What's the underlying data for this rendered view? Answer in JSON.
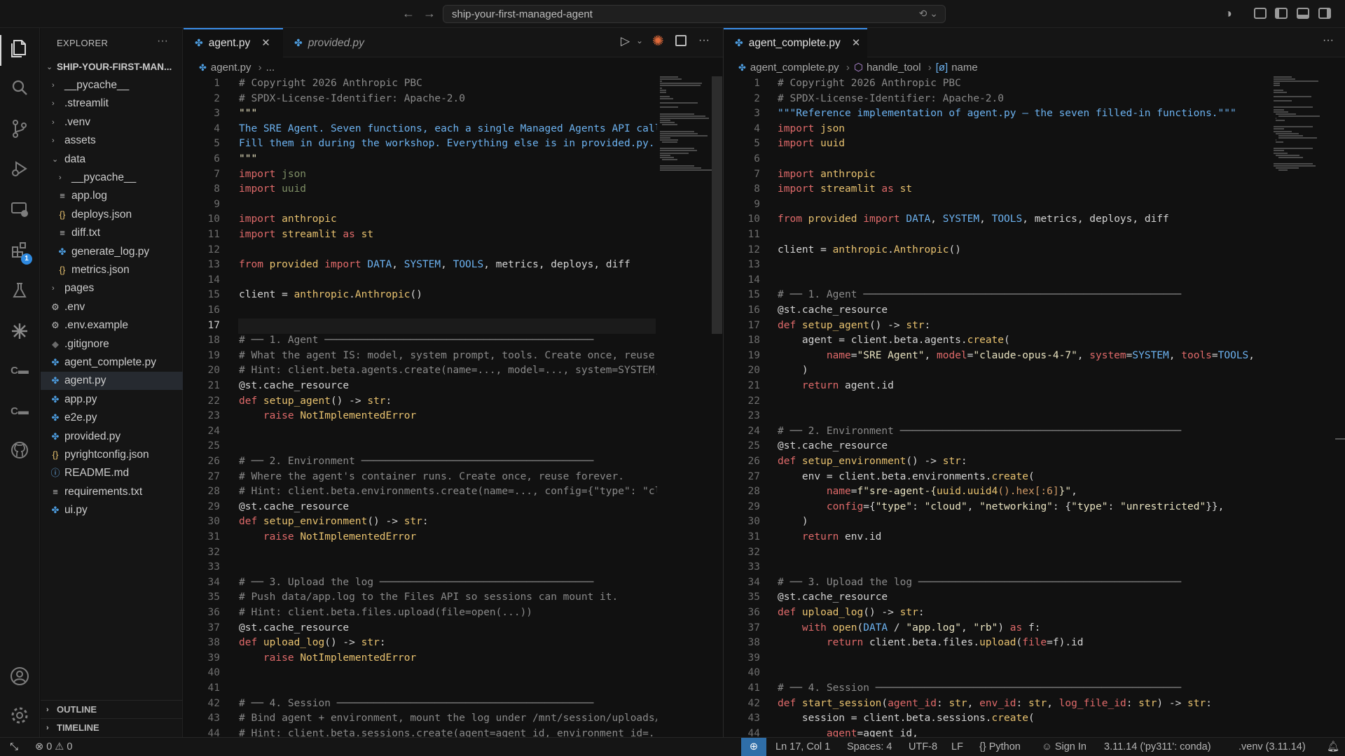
{
  "window": {
    "search_text": "ship-your-first-managed-agent"
  },
  "sidebar": {
    "title": "EXPLORER",
    "more": "···",
    "root": "SHIP-YOUR-FIRST-MAN...",
    "tree": [
      {
        "name": "__pycache__",
        "kind": "folder",
        "depth": 1,
        "open": false
      },
      {
        "name": ".streamlit",
        "kind": "folder",
        "depth": 1,
        "open": false
      },
      {
        "name": ".venv",
        "kind": "folder",
        "depth": 1,
        "open": false
      },
      {
        "name": "assets",
        "kind": "folder",
        "depth": 1,
        "open": false
      },
      {
        "name": "data",
        "kind": "folder",
        "depth": 1,
        "open": true
      },
      {
        "name": "__pycache__",
        "kind": "folder",
        "depth": 2,
        "open": false
      },
      {
        "name": "app.log",
        "kind": "text",
        "depth": 2
      },
      {
        "name": "deploys.json",
        "kind": "json",
        "depth": 2
      },
      {
        "name": "diff.txt",
        "kind": "text",
        "depth": 2
      },
      {
        "name": "generate_log.py",
        "kind": "python",
        "depth": 2
      },
      {
        "name": "metrics.json",
        "kind": "json",
        "depth": 2
      },
      {
        "name": "pages",
        "kind": "folder",
        "depth": 1,
        "open": false
      },
      {
        "name": ".env",
        "kind": "gear",
        "depth": 1
      },
      {
        "name": ".env.example",
        "kind": "gear",
        "depth": 1
      },
      {
        "name": ".gitignore",
        "kind": "git",
        "depth": 1
      },
      {
        "name": "agent_complete.py",
        "kind": "python",
        "depth": 1
      },
      {
        "name": "agent.py",
        "kind": "python",
        "depth": 1,
        "selected": true
      },
      {
        "name": "app.py",
        "kind": "python",
        "depth": 1
      },
      {
        "name": "e2e.py",
        "kind": "python",
        "depth": 1
      },
      {
        "name": "provided.py",
        "kind": "python",
        "depth": 1
      },
      {
        "name": "pyrightconfig.json",
        "kind": "json",
        "depth": 1
      },
      {
        "name": "README.md",
        "kind": "info",
        "depth": 1
      },
      {
        "name": "requirements.txt",
        "kind": "text",
        "depth": 1
      },
      {
        "name": "ui.py",
        "kind": "python",
        "depth": 1
      }
    ],
    "outline": "OUTLINE",
    "timeline": "TIMELINE"
  },
  "activity": {
    "extensions_badge": "1"
  },
  "left_editor": {
    "tabs": [
      {
        "label": "agent.py",
        "active": true,
        "italic": false,
        "close": "✕"
      },
      {
        "label": "provided.py",
        "active": false,
        "italic": true,
        "close": ""
      }
    ],
    "breadcrumb": [
      "agent.py",
      "..."
    ],
    "current_line": 17,
    "lines": [
      [
        [
          "# Copyright 2026 Anthropic PBC",
          "com"
        ]
      ],
      [
        [
          "# SPDX-License-Identifier: Apache-2.0",
          "com"
        ]
      ],
      [
        [
          "\"\"\"",
          "str"
        ]
      ],
      [
        [
          "The SRE Agent. Seven functions, each a single Managed Agents API call.",
          "blue"
        ]
      ],
      [
        [
          "Fill them in during the workshop. Everything else is in provided.py.",
          "blue"
        ]
      ],
      [
        [
          "\"\"\"",
          "str"
        ]
      ],
      [
        [
          "import ",
          "kw"
        ],
        [
          "json",
          "dim"
        ]
      ],
      [
        [
          "import ",
          "kw"
        ],
        [
          "uuid",
          "dim"
        ]
      ],
      [],
      [
        [
          "import ",
          "kw"
        ],
        [
          "anthropic",
          "fn"
        ]
      ],
      [
        [
          "import ",
          "kw"
        ],
        [
          "streamlit ",
          "fn"
        ],
        [
          "as ",
          "kw"
        ],
        [
          "st",
          "fn"
        ]
      ],
      [],
      [
        [
          "from ",
          "kw"
        ],
        [
          "provided ",
          "fn"
        ],
        [
          "import ",
          "kw"
        ],
        [
          "DATA",
          "blue"
        ],
        [
          ", ",
          ""
        ],
        [
          "SYSTEM",
          "blue"
        ],
        [
          ", ",
          ""
        ],
        [
          "TOOLS",
          "blue"
        ],
        [
          ", metrics, deploys, diff",
          ""
        ]
      ],
      [],
      [
        [
          "client = ",
          ""
        ],
        [
          "anthropic",
          "fn"
        ],
        [
          ".",
          ""
        ],
        [
          "Anthropic",
          "fn"
        ],
        [
          "()",
          ""
        ]
      ],
      [],
      [],
      [
        [
          "# ── 1. Agent ────────────────────────────────────────────",
          "com"
        ]
      ],
      [
        [
          "# What the agent IS: model, system prompt, tools. Create once, reuse forever.",
          "com"
        ]
      ],
      [
        [
          "# Hint: client.beta.agents.create(name=..., model=..., system=SYSTEM, tools=TOOLS)",
          "com"
        ]
      ],
      [
        [
          "@st",
          ""
        ],
        [
          ".cache_resource",
          ""
        ]
      ],
      [
        [
          "def ",
          "kw"
        ],
        [
          "setup_agent",
          "fn"
        ],
        [
          "() -> ",
          ""
        ],
        [
          "str",
          "fn"
        ],
        [
          ":",
          ""
        ]
      ],
      [
        [
          "    raise ",
          "kw"
        ],
        [
          "NotImplementedError",
          "fn"
        ]
      ],
      [],
      [],
      [
        [
          "# ── 2. Environment ──────────────────────────────────────",
          "com"
        ]
      ],
      [
        [
          "# Where the agent's container runs. Create once, reuse forever.",
          "com"
        ]
      ],
      [
        [
          "# Hint: client.beta.environments.create(name=..., config={\"type\": \"cloud\", ...})",
          "com"
        ]
      ],
      [
        [
          "@st",
          ""
        ],
        [
          ".cache_resource",
          ""
        ]
      ],
      [
        [
          "def ",
          "kw"
        ],
        [
          "setup_environment",
          "fn"
        ],
        [
          "() -> ",
          ""
        ],
        [
          "str",
          "fn"
        ],
        [
          ":",
          ""
        ]
      ],
      [
        [
          "    raise ",
          "kw"
        ],
        [
          "NotImplementedError",
          "fn"
        ]
      ],
      [],
      [],
      [
        [
          "# ── 3. Upload the log ───────────────────────────────────",
          "com"
        ]
      ],
      [
        [
          "# Push data/app.log to the Files API so sessions can mount it.",
          "com"
        ]
      ],
      [
        [
          "# Hint: client.beta.files.upload(file=open(...))",
          "com"
        ]
      ],
      [
        [
          "@st",
          ""
        ],
        [
          ".cache_resource",
          ""
        ]
      ],
      [
        [
          "def ",
          "kw"
        ],
        [
          "upload_log",
          "fn"
        ],
        [
          "() -> ",
          ""
        ],
        [
          "str",
          "fn"
        ],
        [
          ":",
          ""
        ]
      ],
      [
        [
          "    raise ",
          "kw"
        ],
        [
          "NotImplementedError",
          "fn"
        ]
      ],
      [],
      [],
      [
        [
          "# ── 4. Session ──────────────────────────────────────────",
          "com"
        ]
      ],
      [
        [
          "# Bind agent + environment, mount the log under /mnt/session/uploads/",
          "com"
        ]
      ],
      [
        [
          "# Hint: client.beta.sessions.create(agent=agent_id, environment_id=..., resources=[...])",
          "com"
        ]
      ]
    ]
  },
  "right_editor": {
    "tabs": [
      {
        "label": "agent_complete.py",
        "active": true,
        "italic": false,
        "close": "✕"
      }
    ],
    "breadcrumb": [
      "agent_complete.py",
      "handle_tool",
      "name"
    ],
    "lines": [
      [
        [
          "# Copyright 2026 Anthropic PBC",
          "com"
        ]
      ],
      [
        [
          "# SPDX-License-Identifier: Apache-2.0",
          "com"
        ]
      ],
      [
        [
          "\"\"\"Reference implementation of agent.py — the seven filled-in functions.\"\"\"",
          "blue"
        ]
      ],
      [
        [
          "import ",
          "kw"
        ],
        [
          "json",
          "fn"
        ]
      ],
      [
        [
          "import ",
          "kw"
        ],
        [
          "uuid",
          "fn"
        ]
      ],
      [],
      [
        [
          "import ",
          "kw"
        ],
        [
          "anthropic",
          "fn"
        ]
      ],
      [
        [
          "import ",
          "kw"
        ],
        [
          "streamlit ",
          "fn"
        ],
        [
          "as ",
          "kw"
        ],
        [
          "st",
          "fn"
        ]
      ],
      [],
      [
        [
          "from ",
          "kw"
        ],
        [
          "provided ",
          "fn"
        ],
        [
          "import ",
          "kw"
        ],
        [
          "DATA",
          "blue"
        ],
        [
          ", ",
          ""
        ],
        [
          "SYSTEM",
          "blue"
        ],
        [
          ", ",
          ""
        ],
        [
          "TOOLS",
          "blue"
        ],
        [
          ", metrics, deploys, diff",
          ""
        ]
      ],
      [],
      [
        [
          "client = ",
          ""
        ],
        [
          "anthropic",
          "fn"
        ],
        [
          ".",
          ""
        ],
        [
          "Anthropic",
          "fn"
        ],
        [
          "()",
          ""
        ]
      ],
      [],
      [],
      [
        [
          "# ── 1. Agent ────────────────────────────────────────────────────",
          "com"
        ]
      ],
      [
        [
          "@st",
          ""
        ],
        [
          ".cache_resource",
          ""
        ]
      ],
      [
        [
          "def ",
          "kw"
        ],
        [
          "setup_agent",
          "fn"
        ],
        [
          "() -> ",
          ""
        ],
        [
          "str",
          "fn"
        ],
        [
          ":",
          ""
        ]
      ],
      [
        [
          "    agent = client.beta.agents.",
          ""
        ],
        [
          "create",
          "fn"
        ],
        [
          "(",
          ""
        ]
      ],
      [
        [
          "        ",
          ""
        ],
        [
          "name",
          "kw"
        ],
        [
          "=",
          ""
        ],
        [
          "\"SRE Agent\"",
          "str"
        ],
        [
          ", ",
          ""
        ],
        [
          "model",
          "kw"
        ],
        [
          "=",
          ""
        ],
        [
          "\"claude-opus-4-7\"",
          "str"
        ],
        [
          ", ",
          ""
        ],
        [
          "system",
          "kw"
        ],
        [
          "=",
          ""
        ],
        [
          "SYSTEM",
          "blue"
        ],
        [
          ", ",
          ""
        ],
        [
          "tools",
          "kw"
        ],
        [
          "=",
          ""
        ],
        [
          "TOOLS",
          "blue"
        ],
        [
          ",",
          ""
        ]
      ],
      [
        [
          "    )",
          ""
        ]
      ],
      [
        [
          "    return ",
          "kw"
        ],
        [
          "agent.id",
          ""
        ]
      ],
      [],
      [],
      [
        [
          "# ── 2. Environment ──────────────────────────────────────────────",
          "com"
        ]
      ],
      [
        [
          "@st",
          ""
        ],
        [
          ".cache_resource",
          ""
        ]
      ],
      [
        [
          "def ",
          "kw"
        ],
        [
          "setup_environment",
          "fn"
        ],
        [
          "() -> ",
          ""
        ],
        [
          "str",
          "fn"
        ],
        [
          ":",
          ""
        ]
      ],
      [
        [
          "    env = client.beta.environments.",
          ""
        ],
        [
          "create",
          "fn"
        ],
        [
          "(",
          ""
        ]
      ],
      [
        [
          "        ",
          ""
        ],
        [
          "name",
          "kw"
        ],
        [
          "=",
          ""
        ],
        [
          "f\"sre-agent-{",
          "str"
        ],
        [
          "uuid.uuid4",
          "fn"
        ],
        [
          "().hex[:6]",
          "num"
        ],
        [
          "}\"",
          "str"
        ],
        [
          ",",
          ""
        ]
      ],
      [
        [
          "        ",
          ""
        ],
        [
          "config",
          "kw"
        ],
        [
          "={",
          ""
        ],
        [
          "\"type\"",
          "str"
        ],
        [
          ": ",
          ""
        ],
        [
          "\"cloud\"",
          "str"
        ],
        [
          ", ",
          ""
        ],
        [
          "\"networking\"",
          "str"
        ],
        [
          ": {",
          ""
        ],
        [
          "\"type\"",
          "str"
        ],
        [
          ": ",
          ""
        ],
        [
          "\"unrestricted\"",
          "str"
        ],
        [
          "}},",
          ""
        ]
      ],
      [
        [
          "    )",
          ""
        ]
      ],
      [
        [
          "    return ",
          "kw"
        ],
        [
          "env.id",
          ""
        ]
      ],
      [],
      [],
      [
        [
          "# ── 3. Upload the log ───────────────────────────────────────────",
          "com"
        ]
      ],
      [
        [
          "@st",
          ""
        ],
        [
          ".cache_resource",
          ""
        ]
      ],
      [
        [
          "def ",
          "kw"
        ],
        [
          "upload_log",
          "fn"
        ],
        [
          "() -> ",
          ""
        ],
        [
          "str",
          "fn"
        ],
        [
          ":",
          ""
        ]
      ],
      [
        [
          "    with ",
          "kw"
        ],
        [
          "open",
          "fn"
        ],
        [
          "(",
          ""
        ],
        [
          "DATA",
          "blue"
        ],
        [
          " / ",
          ""
        ],
        [
          "\"app.log\"",
          "str"
        ],
        [
          ", ",
          ""
        ],
        [
          "\"rb\"",
          "str"
        ],
        [
          ") ",
          ""
        ],
        [
          "as ",
          "kw"
        ],
        [
          "f:",
          ""
        ]
      ],
      [
        [
          "        return ",
          "kw"
        ],
        [
          "client.beta.files.",
          ""
        ],
        [
          "upload",
          "fn"
        ],
        [
          "(",
          ""
        ],
        [
          "file",
          "kw"
        ],
        [
          "=f).id",
          ""
        ]
      ],
      [],
      [],
      [
        [
          "# ── 4. Session ──────────────────────────────────────────────────",
          "com"
        ]
      ],
      [
        [
          "def ",
          "kw"
        ],
        [
          "start_session",
          "fn"
        ],
        [
          "(",
          ""
        ],
        [
          "agent_id",
          "kw"
        ],
        [
          ": ",
          ""
        ],
        [
          "str",
          "fn"
        ],
        [
          ", ",
          ""
        ],
        [
          "env_id",
          "kw"
        ],
        [
          ": ",
          ""
        ],
        [
          "str",
          "fn"
        ],
        [
          ", ",
          ""
        ],
        [
          "log_file_id",
          "kw"
        ],
        [
          ": ",
          ""
        ],
        [
          "str",
          "fn"
        ],
        [
          ") -> ",
          ""
        ],
        [
          "str",
          "fn"
        ],
        [
          ":",
          ""
        ]
      ],
      [
        [
          "    session = client.beta.sessions.",
          ""
        ],
        [
          "create",
          "fn"
        ],
        [
          "(",
          ""
        ]
      ],
      [
        [
          "        ",
          ""
        ],
        [
          "agent",
          "kw"
        ],
        [
          "=agent_id,",
          ""
        ]
      ]
    ]
  },
  "statusbar": {
    "errors": "0",
    "warnings": "0",
    "position": "Ln 17, Col 1",
    "spaces": "Spaces: 4",
    "encoding": "UTF-8",
    "eol": "LF",
    "language": "Python",
    "sign_in": "Sign In",
    "interpreter": "3.11.14 ('py311': conda)",
    "venv": ".venv (3.11.14)"
  },
  "colors": {
    "accent": "#3b8eea",
    "comment": "#8a8a8a",
    "keyword": "#e06a6a",
    "function": "#e8c26f",
    "builtin": "#6cb2f0",
    "python_icon": "#4d9de0",
    "json_icon": "#e8c26f"
  }
}
